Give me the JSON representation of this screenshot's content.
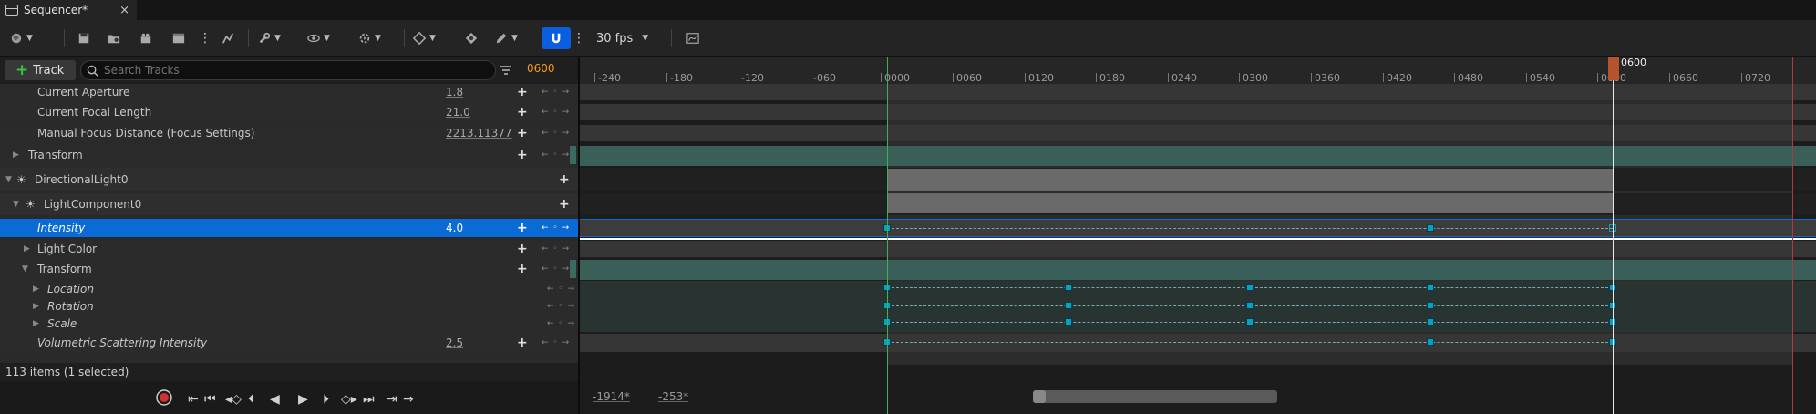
{
  "tab": {
    "title": "Sequencer*",
    "close": "×"
  },
  "toolbar": {
    "fps": "30 fps"
  },
  "filter": {
    "add_track_label": "Track",
    "search_placeholder": "Search Tracks",
    "current_frame": "0600"
  },
  "tracks": [
    {
      "label": "Current Aperture",
      "value": "1.8"
    },
    {
      "label": "Current Focal Length",
      "value": "21.0"
    },
    {
      "label": "Manual Focus Distance (Focus Settings)",
      "value": "2213.11377"
    },
    {
      "label": "Transform"
    },
    {
      "label": "DirectionalLight0"
    },
    {
      "label": "LightComponent0"
    },
    {
      "label": "Intensity",
      "value": "4.0"
    },
    {
      "label": "Light Color"
    },
    {
      "label": "Transform"
    },
    {
      "label": "Location"
    },
    {
      "label": "Rotation"
    },
    {
      "label": "Scale"
    },
    {
      "label": "Volumetric Scattering Intensity",
      "value": "2.5"
    }
  ],
  "status": {
    "text": "113 items (1 selected)"
  },
  "ruler": {
    "labels": [
      "-240",
      "-180",
      "-120",
      "-060",
      "0000",
      "0060",
      "0120",
      "0180",
      "0240",
      "0300",
      "0360",
      "0420",
      "0480",
      "0540",
      "0600",
      "0660",
      "0720"
    ],
    "playhead_label": "0600"
  },
  "view_range": {
    "start": "-1914*",
    "end": "-253*"
  },
  "colors": {
    "selection": "#0a6ad6",
    "accent_orange": "#f29b1c",
    "snap_blue": "#0a5ee0"
  }
}
